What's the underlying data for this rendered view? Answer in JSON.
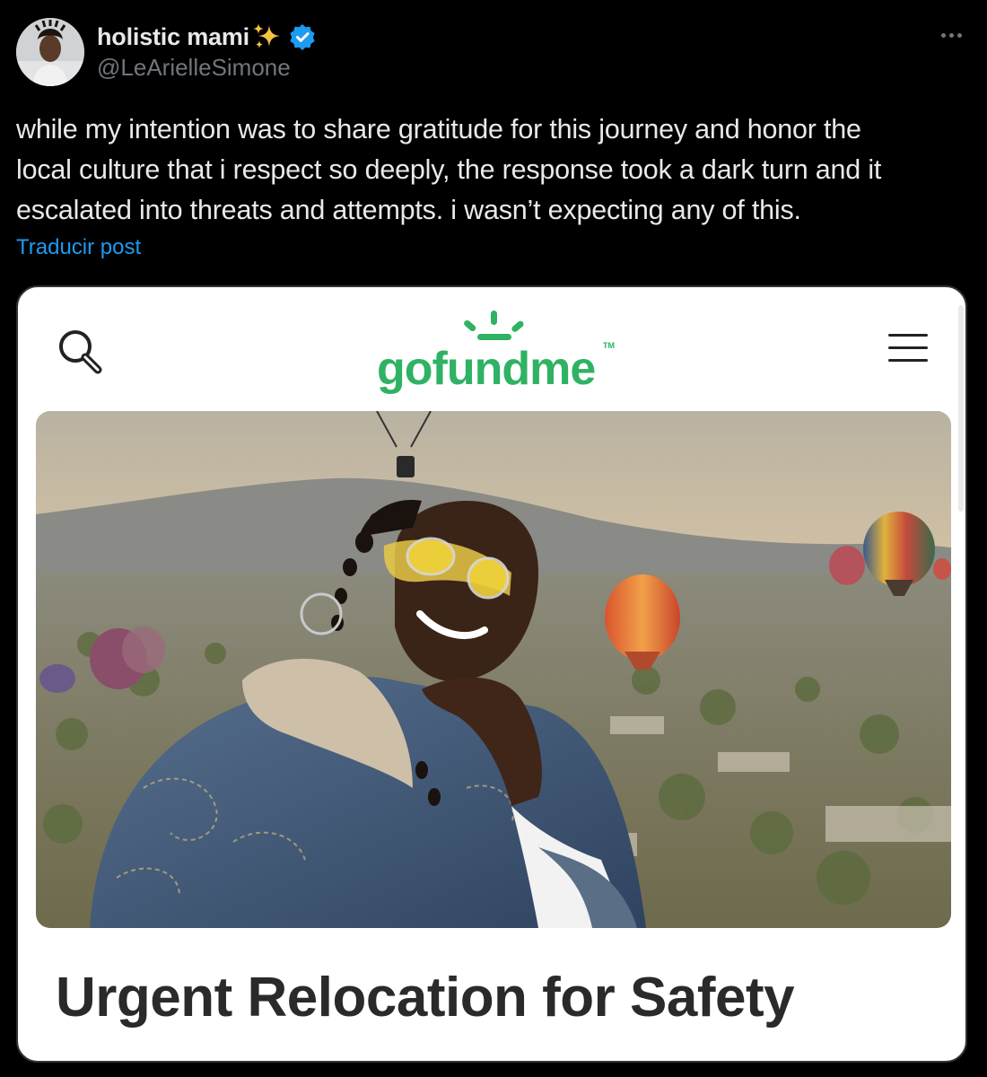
{
  "tweet": {
    "author": {
      "display_name": "holistic mami",
      "handle": "@LeArielleSimone",
      "emoji_icon": "sparkles-icon",
      "verified_icon": "verified-badge-icon",
      "verified_color": "#1d9bf0"
    },
    "more_icon": "more-dots-icon",
    "lines": [
      "while my intention was to share gratitude for this journey and honor the",
      "local culture that i respect so deeply, the response took a dark turn and it",
      "escalated into threats and attempts. i wasn’t expecting any of this."
    ],
    "translate_label": "Traducir post"
  },
  "gofundme": {
    "logo_text": "gofundme",
    "logo_tm": "TM",
    "brand_color": "#2fb264",
    "search_icon": "search-icon",
    "menu_icon": "hamburger-menu-icon",
    "campaign_title": "Urgent Relocation for Safety"
  },
  "colors": {
    "background": "#000000",
    "text_primary": "#e7e9ea",
    "text_secondary": "#71767b",
    "link": "#1d9bf0"
  }
}
